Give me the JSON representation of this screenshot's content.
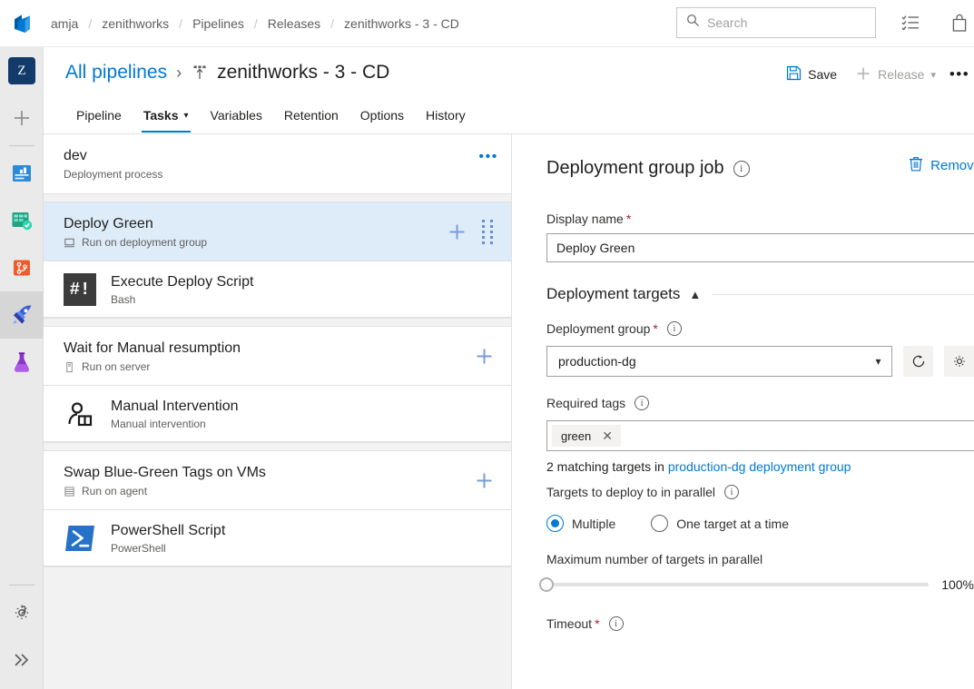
{
  "topbar": {
    "org": "amja",
    "project": "zenithworks",
    "section": "Pipelines",
    "subsection": "Releases",
    "current": "zenithworks - 3 - CD",
    "separator": "/",
    "search_placeholder": "Search",
    "icons": {
      "search": "search-icon",
      "tasks": "tasks-list-icon",
      "marketplace": "shopping-bag-icon"
    }
  },
  "rail": {
    "project_initial": "Z",
    "items": [
      {
        "name": "project-avatar",
        "label": "Z"
      },
      {
        "name": "new-item",
        "label": "+"
      },
      {
        "name": "overview",
        "label": "Overview"
      },
      {
        "name": "boards",
        "label": "Boards"
      },
      {
        "name": "repos",
        "label": "Repos"
      },
      {
        "name": "pipelines",
        "label": "Pipelines"
      },
      {
        "name": "test-plans",
        "label": "Test Plans"
      }
    ],
    "bottom": [
      {
        "name": "project-settings",
        "label": "Project settings"
      },
      {
        "name": "expand",
        "label": "Expand"
      }
    ]
  },
  "pipeline_header": {
    "all_pipelines": "All pipelines",
    "chevron": "›",
    "title": "zenithworks - 3 - CD",
    "save_label": "Save",
    "release_label": "Release",
    "more_label": "•••"
  },
  "tabs": [
    {
      "label": "Pipeline",
      "active": false,
      "caret": false
    },
    {
      "label": "Tasks",
      "active": true,
      "caret": true
    },
    {
      "label": "Variables",
      "active": false,
      "caret": false
    },
    {
      "label": "Retention",
      "active": false,
      "caret": false
    },
    {
      "label": "Options",
      "active": false,
      "caret": false
    },
    {
      "label": "History",
      "active": false,
      "caret": false
    }
  ],
  "task_list": {
    "process": {
      "name": "dev",
      "subtitle": "Deployment process"
    },
    "phases": [
      {
        "name": "Deploy Green",
        "subtitle": "Run on deployment group",
        "selected": true,
        "agent_icon": "deployment-group-icon",
        "has_drag_handle": true,
        "tasks": [
          {
            "name": "Execute Deploy Script",
            "subtitle": "Bash",
            "icon": "bash-icon",
            "icon_text": "#!"
          }
        ]
      },
      {
        "name": "Wait for Manual resumption",
        "subtitle": "Run on server",
        "selected": false,
        "agent_icon": "server-icon",
        "has_drag_handle": false,
        "tasks": [
          {
            "name": "Manual Intervention",
            "subtitle": "Manual intervention",
            "icon": "manual-intervention-icon"
          }
        ]
      },
      {
        "name": "Swap Blue-Green Tags on VMs",
        "subtitle": "Run on agent",
        "selected": false,
        "agent_icon": "agent-icon",
        "has_drag_handle": false,
        "tasks": [
          {
            "name": "PowerShell Script",
            "subtitle": "PowerShell",
            "icon": "powershell-icon"
          }
        ]
      }
    ],
    "add_label": "+"
  },
  "details": {
    "title": "Deployment group job",
    "remove_label": "Remove",
    "display_name": {
      "label": "Display name",
      "required": true,
      "value": "Deploy Green"
    },
    "section": {
      "label": "Deployment targets",
      "expanded": true
    },
    "deployment_group": {
      "label": "Deployment group",
      "required": true,
      "value": "production-dg",
      "refresh_icon": "refresh-icon",
      "manage_icon": "gear-icon"
    },
    "required_tags": {
      "label": "Required tags",
      "tags": [
        "green"
      ]
    },
    "matching": {
      "prefix": "2 matching targets in ",
      "link": "production-dg deployment group",
      "count": 2
    },
    "parallel": {
      "label": "Targets to deploy to in parallel",
      "options": [
        {
          "label": "Multiple",
          "selected": true
        },
        {
          "label": "One target at a time",
          "selected": false
        }
      ]
    },
    "max_parallel": {
      "label": "Maximum number of targets in parallel",
      "value": "100%",
      "percent": 0
    },
    "timeout": {
      "label": "Timeout",
      "required": true
    }
  },
  "colors": {
    "accent": "#0078d4",
    "selected_row": "#deecf9",
    "rail_bg": "#eaeaea",
    "pane_bg": "#f2f2f2",
    "required": "#a4262c"
  }
}
